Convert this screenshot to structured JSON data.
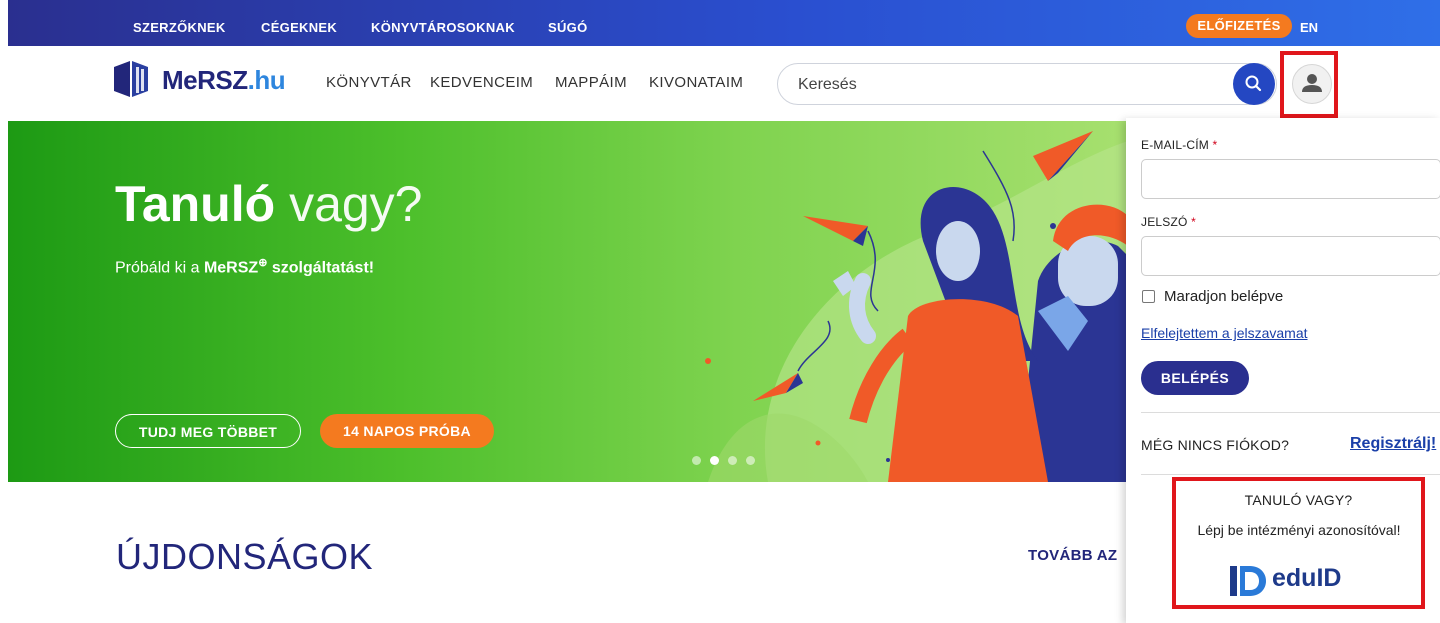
{
  "topbar": {
    "links": [
      "SZERZŐKNEK",
      "CÉGEKNEK",
      "KÖNYVTÁROSOKNAK",
      "SÚGÓ"
    ],
    "subscribe_label": "ELŐFIZETÉS",
    "lang_label": "EN"
  },
  "header": {
    "logo_main": "MeRSZ",
    "logo_tld": ".hu",
    "nav": [
      "KÖNYVTÁR",
      "KEDVENCEIM",
      "MAPPÁIM",
      "KIVONATAIM"
    ],
    "search_placeholder": "Keresés"
  },
  "hero": {
    "title_bold": "Tanuló",
    "title_light": "vagy?",
    "subtitle_prefix": "Próbáld ki a",
    "subtitle_brand": "MeRSZ",
    "subtitle_suffix": "szolgáltatást!",
    "button_more": "TUDJ MEG TÖBBET",
    "button_trial": "14 NAPOS PRÓBA",
    "slide_count": 4,
    "active_slide": 2
  },
  "news": {
    "title": "ÚJDONSÁGOK",
    "more_link": "TOVÁBB AZ"
  },
  "login": {
    "email_label": "E-MAIL-CÍM",
    "password_label": "JELSZÓ",
    "required_mark": "*",
    "remember_label": "Maradjon belépve",
    "forgot_link": "Elfelejtettem a jelszavamat",
    "submit_label": "BELÉPÉS",
    "no_account": "MÉG NINCS FIÓKOD?",
    "register_link": "Regisztrálj!",
    "edu_title": "TANULÓ VAGY?",
    "edu_subtitle": "Lépj be intézményi azonosítóval!",
    "eduid_label": "eduID"
  },
  "colors": {
    "brand_navy": "#22267a",
    "accent_orange": "#f47a1f",
    "highlight_red": "#e0161b",
    "hero_green": "#4cbf2b"
  }
}
